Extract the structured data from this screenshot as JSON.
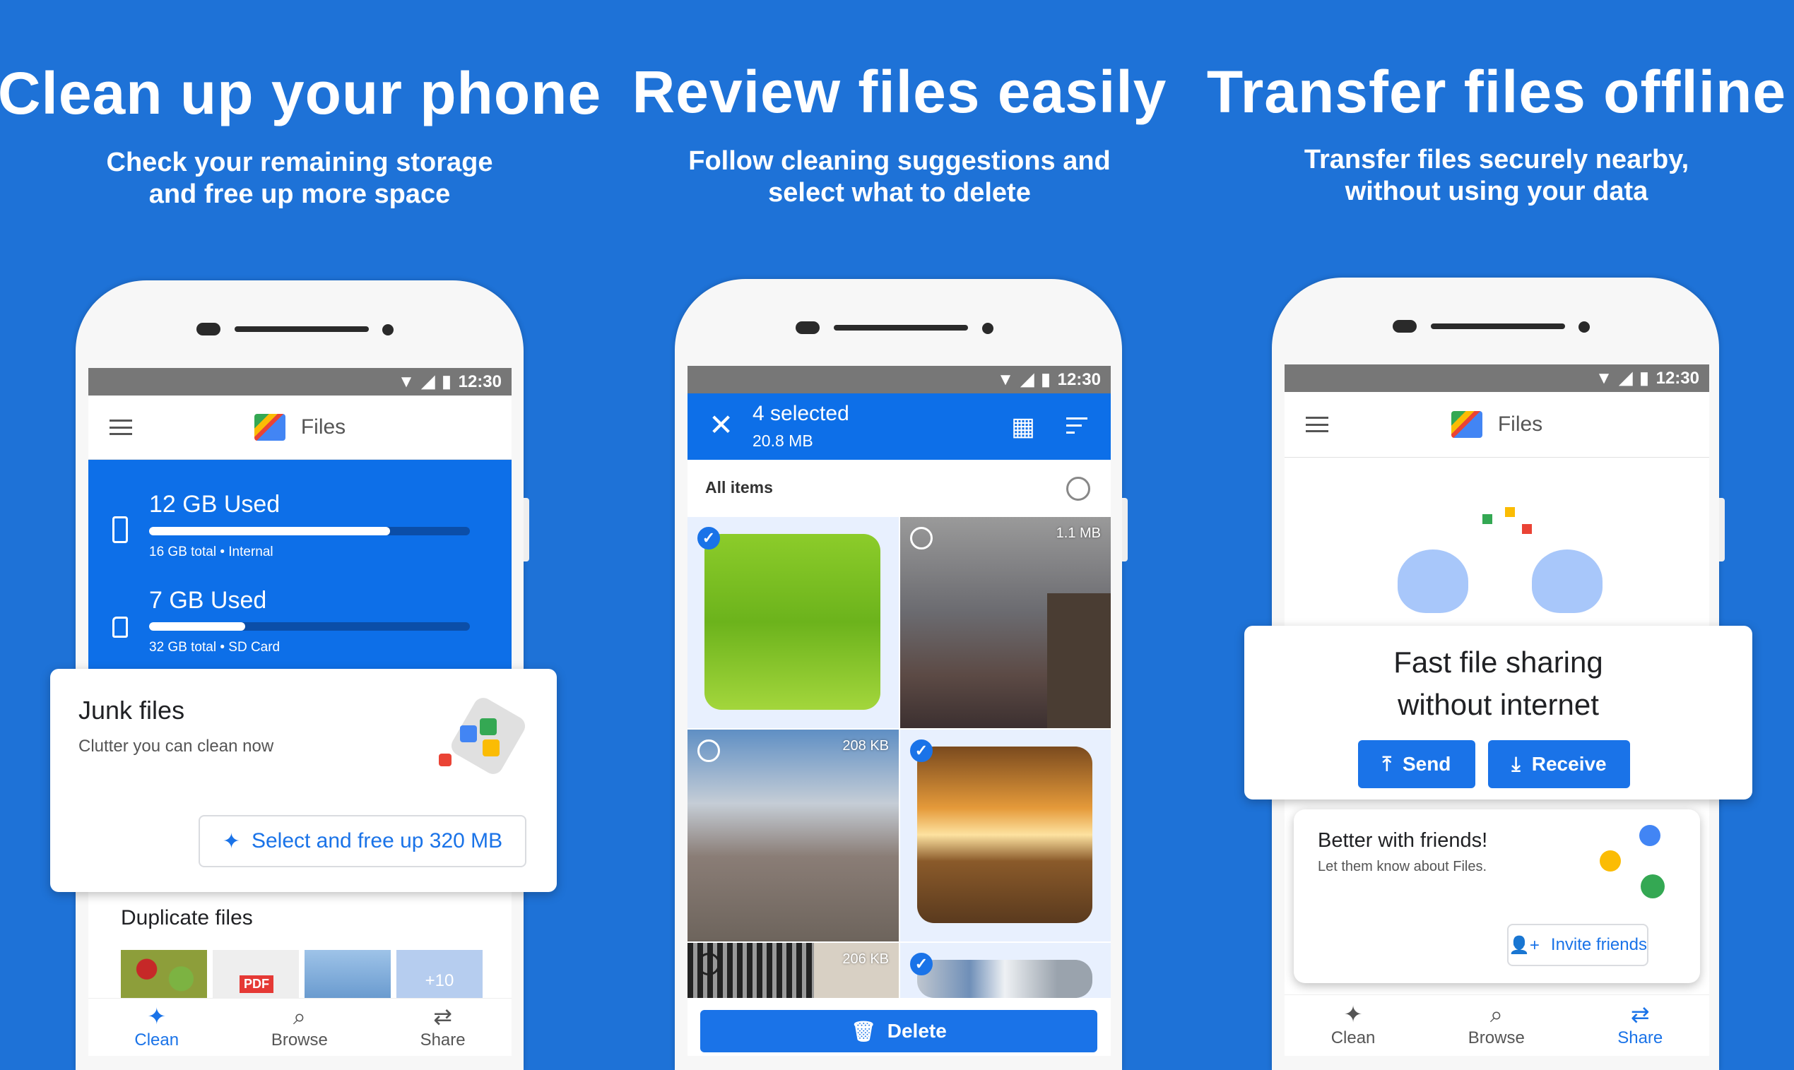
{
  "colors": {
    "background": "#1e72d7",
    "accent": "#1a73e8",
    "status_bar": "#777777"
  },
  "panels": [
    {
      "title": "Clean up your phone",
      "subtitle": [
        "Check your remaining storage",
        "and free up more space"
      ]
    },
    {
      "title": "Review files easily",
      "subtitle": [
        "Follow cleaning suggestions and",
        "select what to delete"
      ]
    },
    {
      "title": "Transfer files offline",
      "subtitle": [
        "Transfer files securely nearby,",
        "without using your data"
      ]
    }
  ],
  "status": {
    "time": "12:30",
    "icons": [
      "wifi-icon",
      "signal-icon",
      "battery-icon"
    ]
  },
  "app": {
    "name": "Files"
  },
  "screen1": {
    "storage": [
      {
        "used": "12 GB Used",
        "detail": "16 GB total • Internal",
        "fraction": 0.75,
        "icon": "phone-icon"
      },
      {
        "used": "7 GB Used",
        "detail": "32 GB total • SD Card",
        "fraction": 0.3,
        "icon": "sd-card-icon"
      }
    ],
    "junk": {
      "title": "Junk files",
      "subtitle": "Clutter you can clean now",
      "button": "Select and free up 320 MB"
    },
    "duplicates": {
      "title": "Duplicate files",
      "more": "+10",
      "pdf": "PDF"
    }
  },
  "screen2": {
    "selected": "4 selected",
    "size": "20.8 MB",
    "all_items": "All items",
    "grid": [
      {
        "selected": true,
        "size": ""
      },
      {
        "selected": false,
        "size": "1.1 MB"
      },
      {
        "selected": false,
        "size": "208 KB"
      },
      {
        "selected": true,
        "size": ""
      },
      {
        "selected": false,
        "size": "206 KB"
      },
      {
        "selected": true,
        "size": ""
      }
    ],
    "delete": "Delete"
  },
  "screen3": {
    "headline": [
      "Fast file sharing",
      "without internet"
    ],
    "send": "Send",
    "receive": "Receive",
    "friends": {
      "title": "Better with friends!",
      "subtitle": "Let them know about Files.",
      "button": "Invite friends"
    }
  },
  "nav": {
    "items": [
      "Clean",
      "Browse",
      "Share"
    ]
  }
}
